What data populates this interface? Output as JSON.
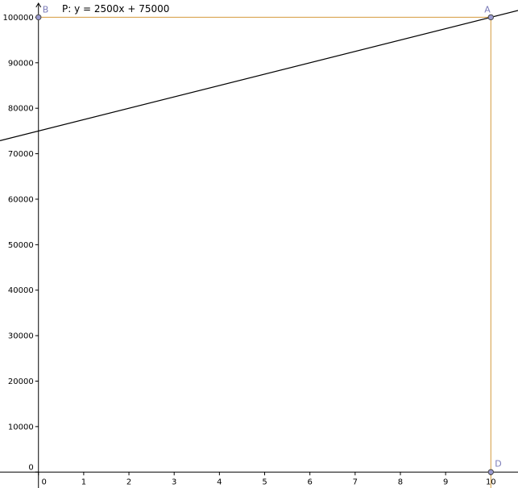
{
  "chart_data": {
    "type": "line",
    "xlim": [
      -0.85,
      10.6
    ],
    "ylim": [
      -3500,
      103800
    ],
    "x_ticks": [
      0,
      1,
      2,
      3,
      4,
      5,
      6,
      7,
      8,
      9,
      10
    ],
    "y_ticks": [
      0,
      10000,
      20000,
      30000,
      40000,
      50000,
      60000,
      70000,
      80000,
      90000,
      100000
    ],
    "x_tick_labels": [
      "0",
      "1",
      "2",
      "3",
      "4",
      "5",
      "6",
      "7",
      "8",
      "9",
      "10"
    ],
    "y_tick_labels": [
      "0",
      "10000",
      "20000",
      "30000",
      "40000",
      "50000",
      "60000",
      "70000",
      "80000",
      "90000",
      "100000"
    ],
    "line": {
      "equation_label": "P: y = 2500x + 75000",
      "slope": 2500,
      "intercept": 75000,
      "color": "#000000"
    },
    "points": [
      {
        "label": "A",
        "x": 10,
        "y": 100000
      },
      {
        "label": "B",
        "x": 0,
        "y": 100000
      },
      {
        "label": "D",
        "x": 10,
        "y": 0
      }
    ],
    "guide_lines": [
      {
        "from": [
          0,
          100000
        ],
        "to": [
          10,
          100000
        ],
        "color": "#d49a3c"
      },
      {
        "from": [
          10,
          100000
        ],
        "to": [
          10,
          -3500
        ],
        "color": "#d49a3c"
      }
    ],
    "grid": false,
    "colors": {
      "axis": "#000000",
      "point_fill": "#9a9ad0",
      "point_stroke": "#4a4a4a",
      "point_label": "#7b7bb8",
      "guide": "#d49a3c"
    }
  }
}
